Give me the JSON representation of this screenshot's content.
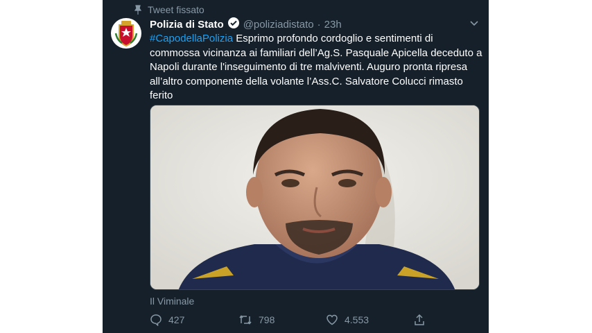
{
  "pinned": {
    "label": "Tweet fissato",
    "icon": "pin-icon"
  },
  "author": {
    "display_name": "Polizia di Stato",
    "handle": "@poliziadistato",
    "separator": "·",
    "time": "23h",
    "verified_icon": "verified-badge-icon",
    "avatar_icon": "police-crest-icon"
  },
  "tweet": {
    "hashtag": "#CapodellaPolizia",
    "text": " Esprimo profondo cordoglio e sentimenti di commossa vicinanza ai familiari dell’Ag.S. Pasquale Apicella deceduto a Napoli durante l'inseguimento di tre malviventi. Auguro pronta ripresa all’altro componente della volante l’Ass.C. Salvatore Colucci rimasto ferito"
  },
  "media": {
    "description_icon": "portrait-photo"
  },
  "source_label": "Il Viminale",
  "actions": {
    "reply_count": "427",
    "retweet_count": "798",
    "like_count": "4.553"
  },
  "colors": {
    "background": "#15202b",
    "accent": "#1da1f2",
    "secondary_text": "#8899a6"
  }
}
